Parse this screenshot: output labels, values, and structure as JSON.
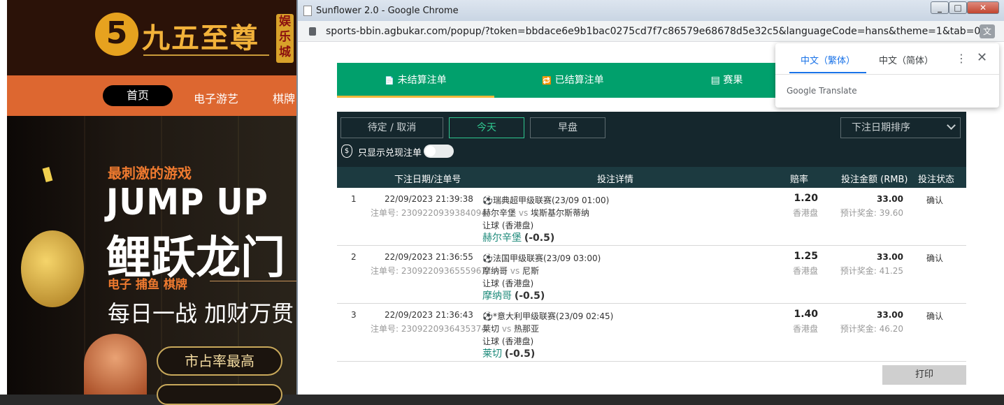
{
  "background_site": {
    "logo_glyph": "5",
    "logo_text": "九五至尊",
    "logo_sub": "娱乐城",
    "nav": [
      "首页",
      "电子游艺",
      "棋牌"
    ],
    "hero_tag": "最刺激的游戏",
    "hero_title_en": "JUMP UP",
    "hero_title_cn": "鲤跃龙门",
    "hero_small": "电子 捕鱼 棋牌",
    "hero_slogan": "每日一战 加财万贯",
    "hero_button": "市占率最高"
  },
  "window": {
    "title": "Sunflower 2.0 - Google Chrome",
    "min_glyph": "_",
    "max_glyph": "□",
    "close_glyph": "✕",
    "url": "sports-bbin.agbukar.com/popup/?token=bbdace6e9b1bac0275cd7f7c86579e68678d5e32c5&languageCode=hans&theme=1&tab=0"
  },
  "translate_popup": {
    "tab1": "中文（繁体）",
    "tab2": "中文（简体）",
    "more": "⋮",
    "close": "✕",
    "brand": "Google Translate"
  },
  "tabs": [
    "未结算注单",
    "已结算注单",
    "赛果"
  ],
  "tab_icons": [
    "📄",
    "🔁",
    "▤"
  ],
  "filters": [
    "待定 / 取消",
    "今天",
    "早盘"
  ],
  "sort_label": "下注日期排序",
  "only_cashout_label": "只显示兑现注单",
  "headers": {
    "date": "下注日期/注单号",
    "detail": "投注详情",
    "odds": "赔率",
    "amount": "投注金额 (RMB)",
    "status": "投注状态"
  },
  "bets": [
    {
      "no": "1",
      "datetime": "22/09/2023 21:39:38",
      "order": "注单号: 2309220939384094",
      "league": "⚽瑞典超甲级联赛(23/09 01:00)",
      "home": "赫尔辛堡",
      "vs": "vs",
      "away": "埃斯基尔斯蒂纳",
      "market": "让球 (香港盘)",
      "pick": "赫尔辛堡",
      "line": "(-0.5)",
      "odds": "1.20",
      "odds_type": "香港盘",
      "amount": "33.00",
      "payout": "预计奖金: 39.60",
      "status": "确认"
    },
    {
      "no": "2",
      "datetime": "22/09/2023 21:36:55",
      "order": "注单号: 2309220936555967",
      "league": "⚽法国甲级联赛(23/09 03:00)",
      "home": "摩纳哥",
      "vs": "vs",
      "away": "尼斯",
      "market": "让球 (香港盘)",
      "pick": "摩纳哥",
      "line": "(-0.5)",
      "odds": "1.25",
      "odds_type": "香港盘",
      "amount": "33.00",
      "payout": "预计奖金: 41.25",
      "status": "确认"
    },
    {
      "no": "3",
      "datetime": "22/09/2023 21:36:43",
      "order": "注单号: 2309220936435374",
      "league": "⚽*意大利甲级联赛(23/09 02:45)",
      "home": "莱切",
      "vs": "vs",
      "away": "热那亚",
      "market": "让球 (香港盘)",
      "pick": "莱切",
      "line": "(-0.5)",
      "odds": "1.40",
      "odds_type": "香港盘",
      "amount": "33.00",
      "payout": "预计奖金: 46.20",
      "status": "确认"
    }
  ],
  "print_label": "打印"
}
